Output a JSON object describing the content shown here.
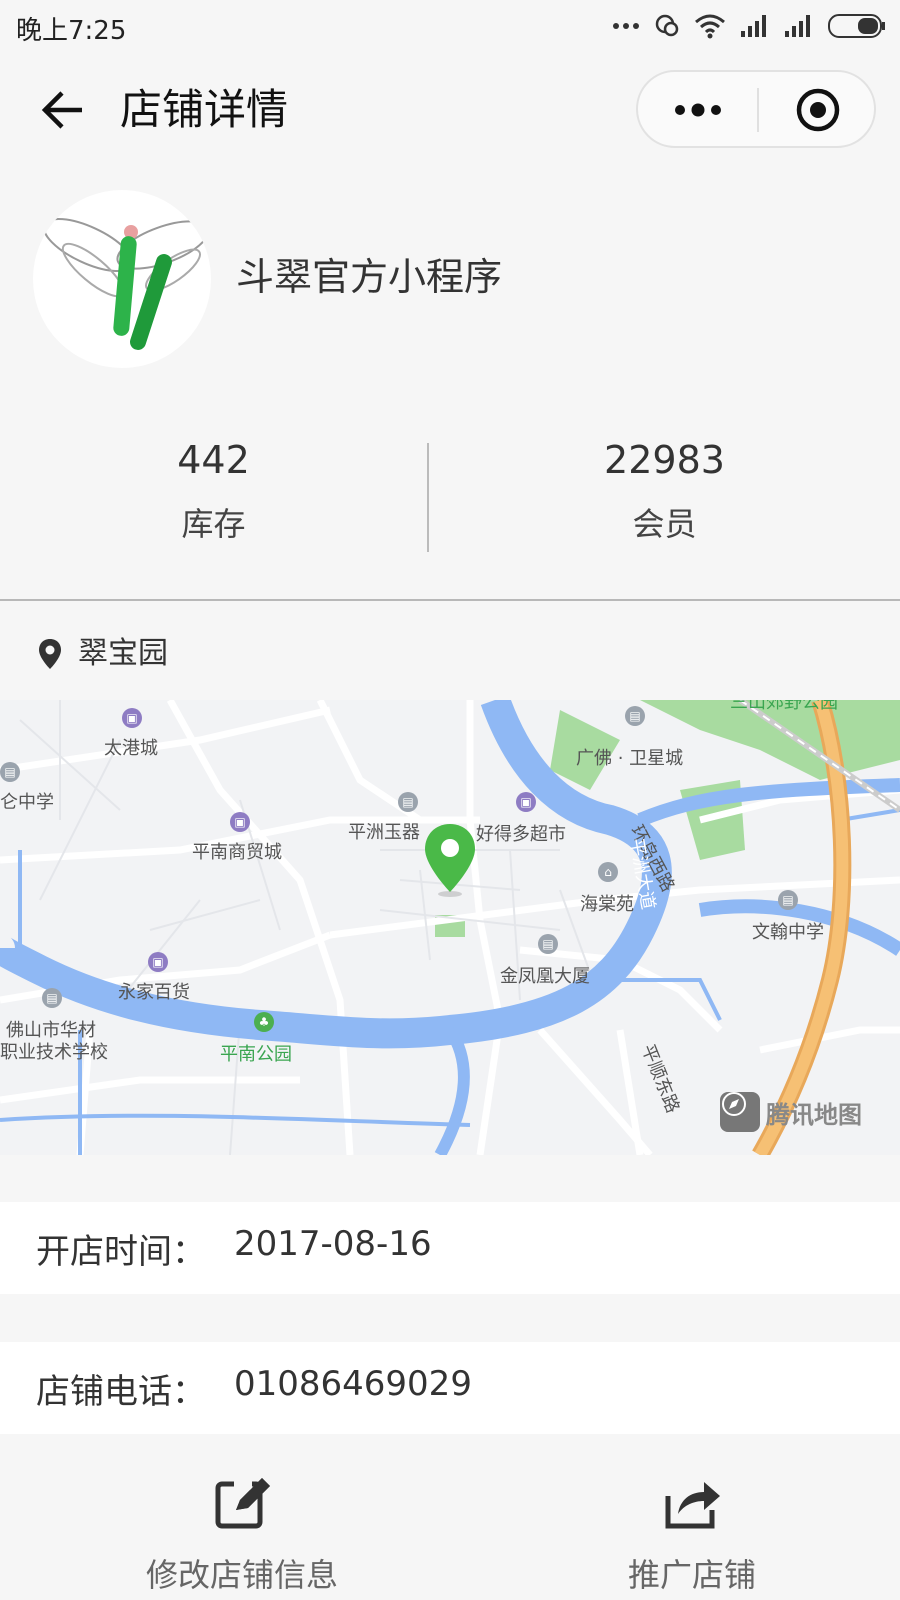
{
  "status_bar": {
    "time": "晚上7:25"
  },
  "nav": {
    "title": "店铺详情"
  },
  "shop": {
    "name": "斗翠官方小程序"
  },
  "stats": [
    {
      "value": "442",
      "label": "库存"
    },
    {
      "value": "22983",
      "label": "会员"
    }
  ],
  "location": {
    "name": "翠宝园"
  },
  "map": {
    "labels": {
      "taigang": "太港城",
      "guangfo": "广佛 · 卫星城",
      "zhongxue": "仑中学",
      "pingnan_shangmao": "平南商贸城",
      "pingzhou_yuqi": "平洲玉器",
      "haode": "好得多超市",
      "haitang": "海棠苑",
      "wenhan": "文翰中学",
      "jinfenghuang": "金凤凰大厦",
      "yongjia": "永家百货",
      "foshan_huacai_1": "佛山市华材",
      "foshan_huacai_2": "职业技术学校",
      "pingnan_park": "平南公园",
      "huandao_road": "环岛西路",
      "pingshun_road": "平顺东路",
      "top_park": "三山郊野公园",
      "river_road": "平洲大道"
    },
    "attribution": "腾讯地图"
  },
  "info": {
    "open_label": "开店时间：",
    "open_value": "2017-08-16",
    "phone_label": "店铺电话：",
    "phone_value": "01086469029"
  },
  "actions": {
    "edit": "修改店铺信息",
    "promote": "推广店铺"
  },
  "colors": {
    "map_water": "#8fb8f4",
    "map_green": "#a8dba0",
    "map_highway": "#f6c074",
    "pin_green": "#4ab948"
  }
}
